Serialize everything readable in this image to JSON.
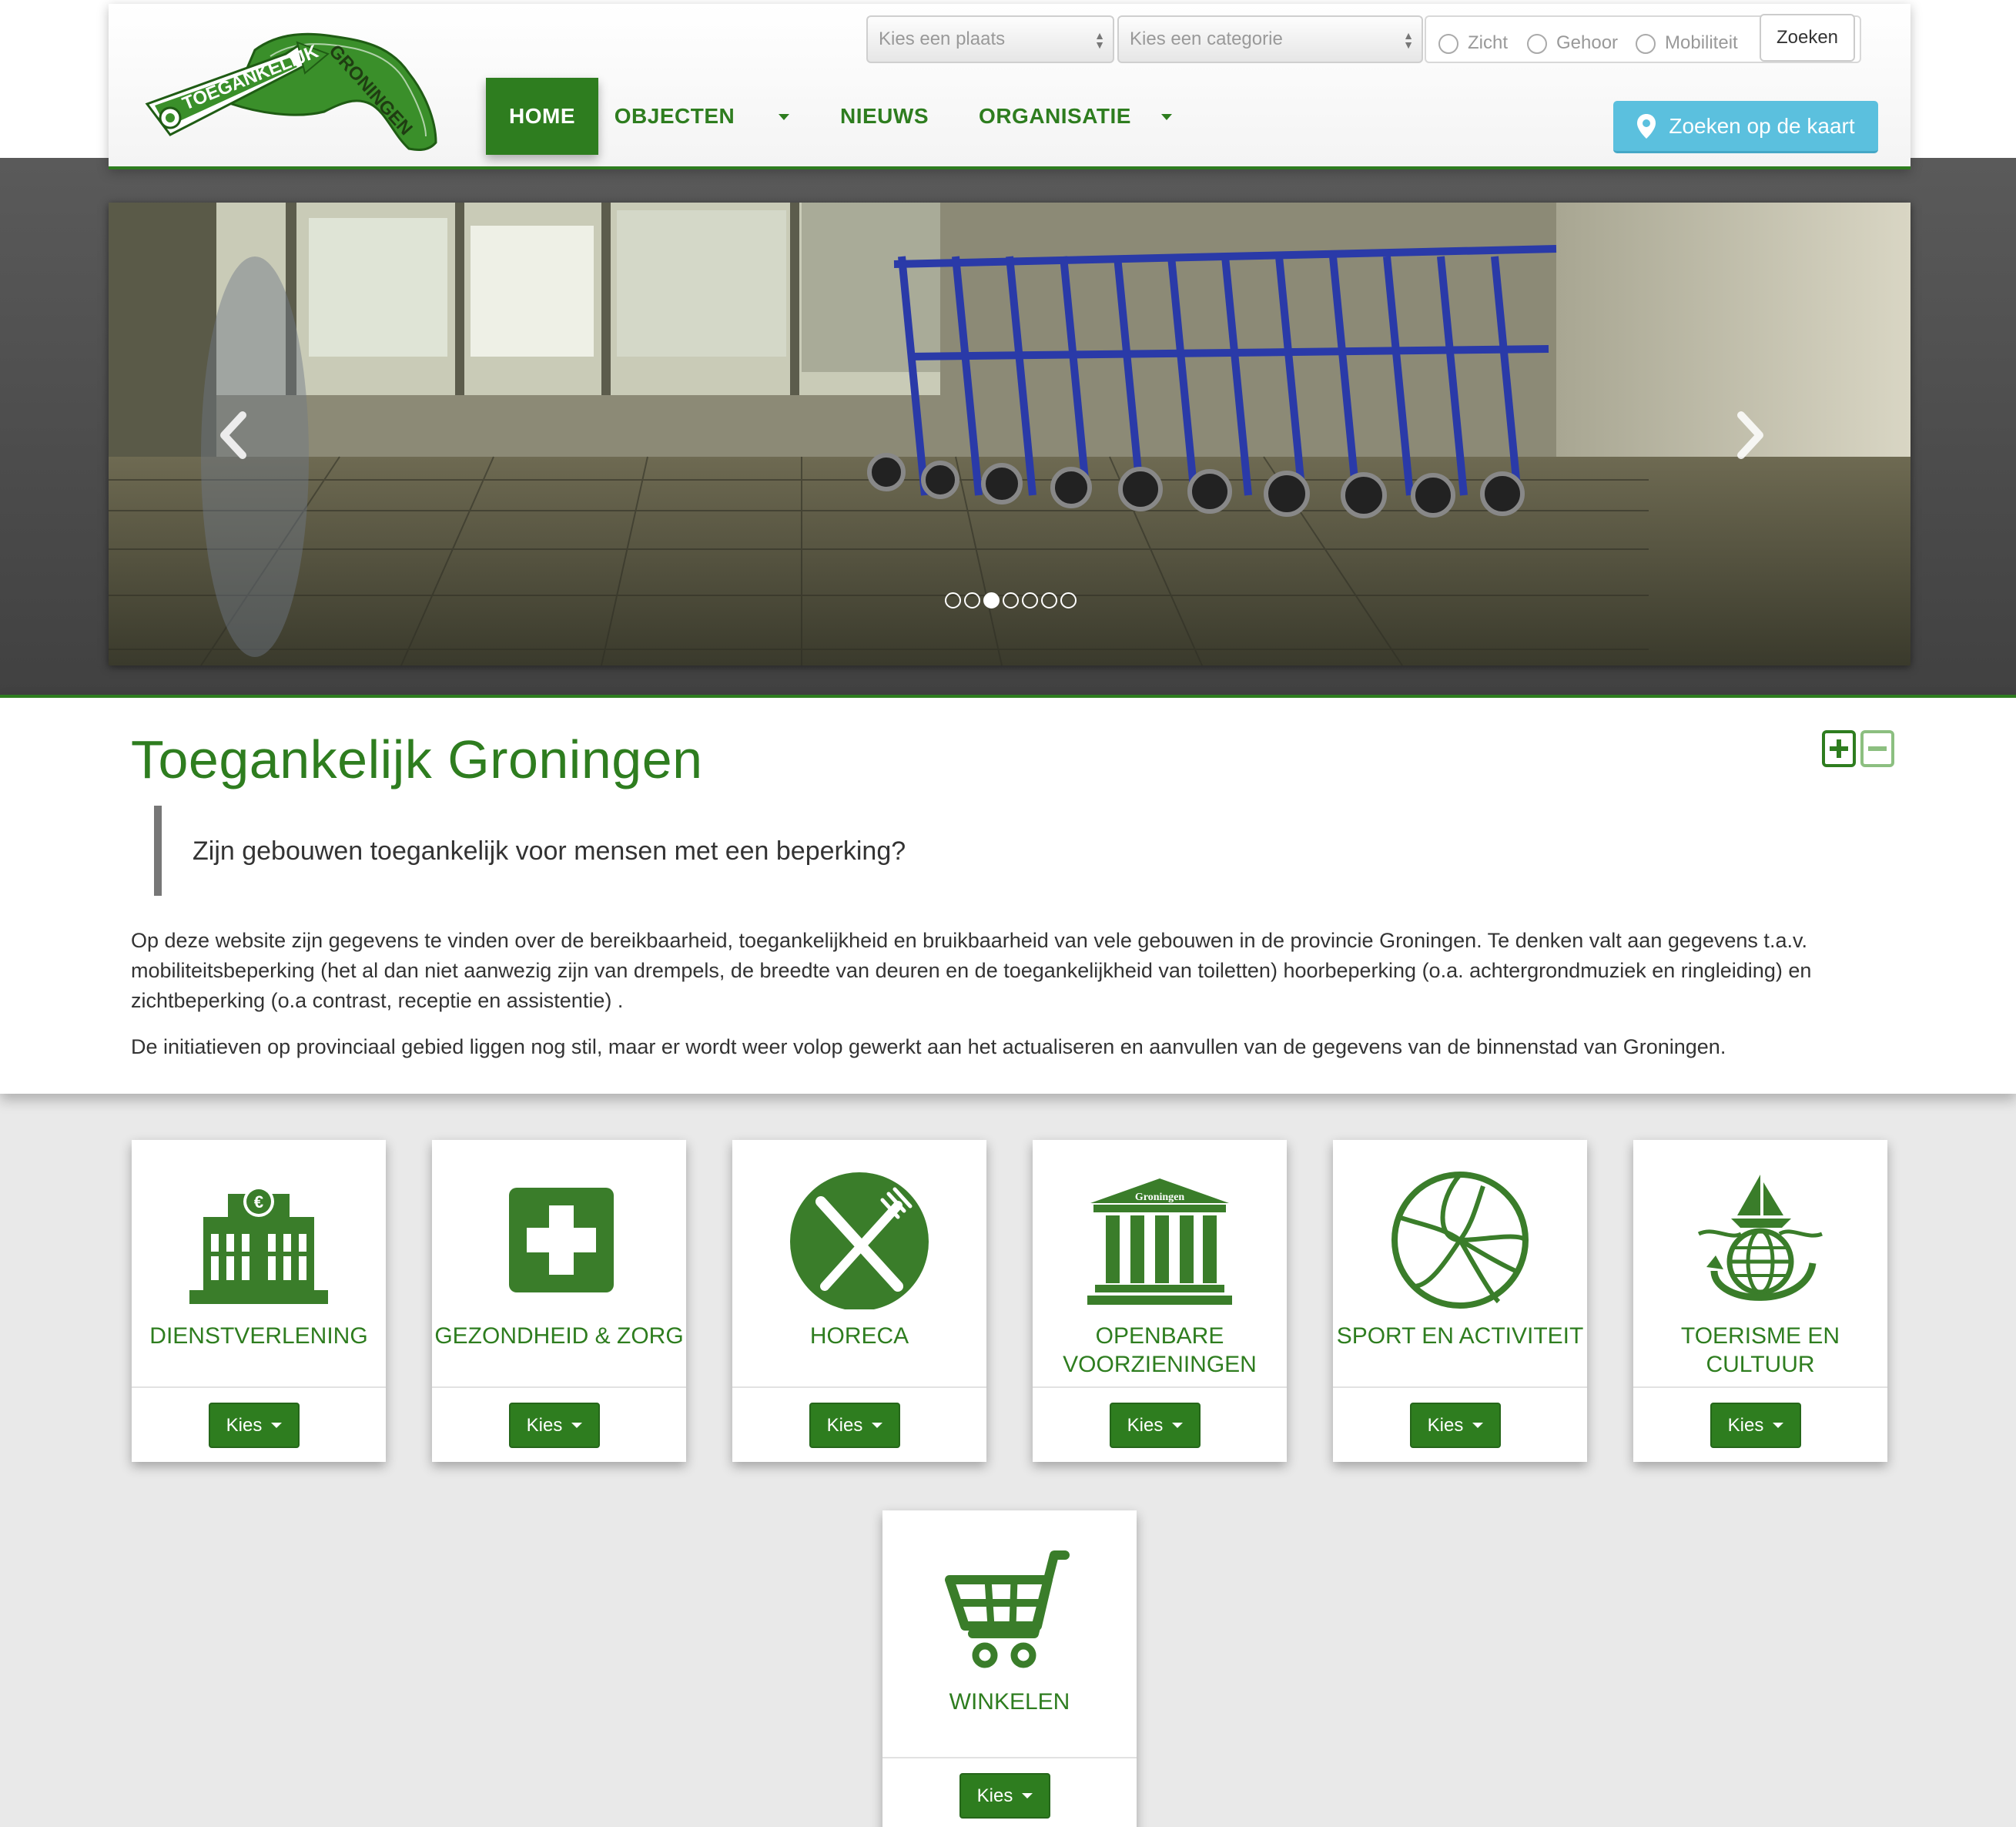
{
  "header": {
    "logo_text_top": "TOEGANKELIJK",
    "logo_text_right": "GRONINGEN",
    "nav": [
      {
        "label": "HOME",
        "active": true
      },
      {
        "label": "OBJECTEN",
        "dropdown": true
      },
      {
        "label": "NIEUWS"
      },
      {
        "label": "ORGANISATIE",
        "dropdown": true
      }
    ],
    "search": {
      "place_placeholder": "Kies een plaats",
      "category_placeholder": "Kies een categorie",
      "filters": [
        "Zicht",
        "Gehoor",
        "Mobiliteit"
      ],
      "submit_label": "Zoeken"
    },
    "map_button_label": "Zoeken op de kaart"
  },
  "carousel": {
    "slide_count": 7,
    "active_index": 2
  },
  "intro": {
    "title": "Toegankelijk Groningen",
    "question": "Zijn gebouwen toegankelijk voor mensen met een beperking?",
    "paragraphs": [
      "Op deze website zijn gegevens te vinden over de bereikbaarheid, toegankelijkheid en bruikbaarheid van vele gebouwen in de provincie Groningen. Te denken valt aan gegevens t.a.v. mobiliteitsbeperking (het al dan niet aanwezig zijn van drempels, de breedte van deuren en de toegankelijkheid van toiletten) hoorbeperking (o.a. achtergrondmuziek en ringleiding) en zichtbeperking (o.a contrast, receptie en assistentie) .",
      "De initiatieven op provinciaal gebied liggen nog stil, maar er wordt weer volop gewerkt aan het actualiseren en aanvullen van de gegevens van de binnenstad van Groningen."
    ]
  },
  "categories": [
    {
      "title": "DIENSTVERLENING",
      "icon": "bank-building-icon",
      "button": "Kies"
    },
    {
      "title": "GEZONDHEID & ZORG",
      "icon": "medical-cross-icon",
      "button": "Kies"
    },
    {
      "title": "HORECA",
      "icon": "fork-knife-icon",
      "button": "Kies"
    },
    {
      "title": "OPENBARE VOORZIENINGEN",
      "icon": "town-hall-icon",
      "button": "Kies",
      "icon_label": "Groningen"
    },
    {
      "title": "SPORT EN ACTIVITEIT",
      "icon": "volleyball-icon",
      "button": "Kies"
    },
    {
      "title": "TOERISME EN CULTUUR",
      "icon": "globe-boat-icon",
      "button": "Kies"
    },
    {
      "title": "WINKELEN",
      "icon": "shopping-cart-icon",
      "button": "Kies"
    }
  ],
  "colors": {
    "brand_green": "#2e7d1f",
    "map_button": "#5bc0de"
  }
}
